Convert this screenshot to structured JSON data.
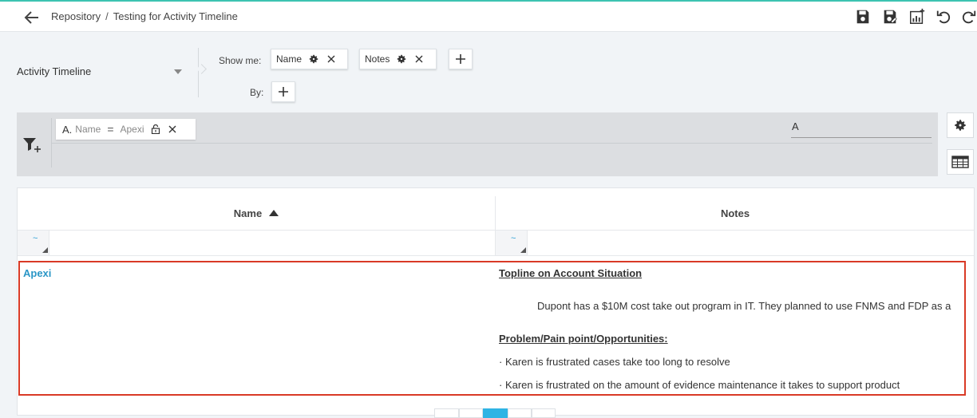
{
  "header": {
    "breadcrumb_root": "Repository",
    "breadcrumb_sep": "/",
    "breadcrumb_current": "Testing for Activity Timeline"
  },
  "toolbar": {
    "icons": [
      "save-icon",
      "save-as-icon",
      "add-chart-icon",
      "undo-icon",
      "refresh-icon"
    ]
  },
  "view_selector": {
    "value": "Activity Timeline"
  },
  "show_me": {
    "label": "Show me:",
    "chips": [
      {
        "label": "Name"
      },
      {
        "label": "Notes"
      }
    ]
  },
  "by": {
    "label": "By:"
  },
  "filter": {
    "conditions": [
      {
        "letter": "A.",
        "field": "Name",
        "operator": "=",
        "value": "Apexi"
      }
    ],
    "logic": "A"
  },
  "table": {
    "columns": [
      {
        "label": "Name",
        "sort": "asc",
        "filter_symbol": "~"
      },
      {
        "label": "Notes",
        "filter_symbol": "~"
      }
    ],
    "rows": [
      {
        "name": "Apexi",
        "notes": {
          "heading1": "Topline on Account Situation",
          "para1": "Dupont has a $10M cost take out program in IT. They planned to use FNMS and FDP as a",
          "heading2": "Problem/Pain point/Opportunities:",
          "bullet1": "· Karen is frustrated cases take too long to resolve",
          "bullet2": "· Karen is frustrated on the amount of evidence maintenance it takes to support product"
        }
      }
    ]
  },
  "colors": {
    "accent_teal": "#3cc3b1",
    "link_blue": "#2a96c6",
    "highlight_red": "#d93a26",
    "pager_active": "#2fb4e4"
  }
}
